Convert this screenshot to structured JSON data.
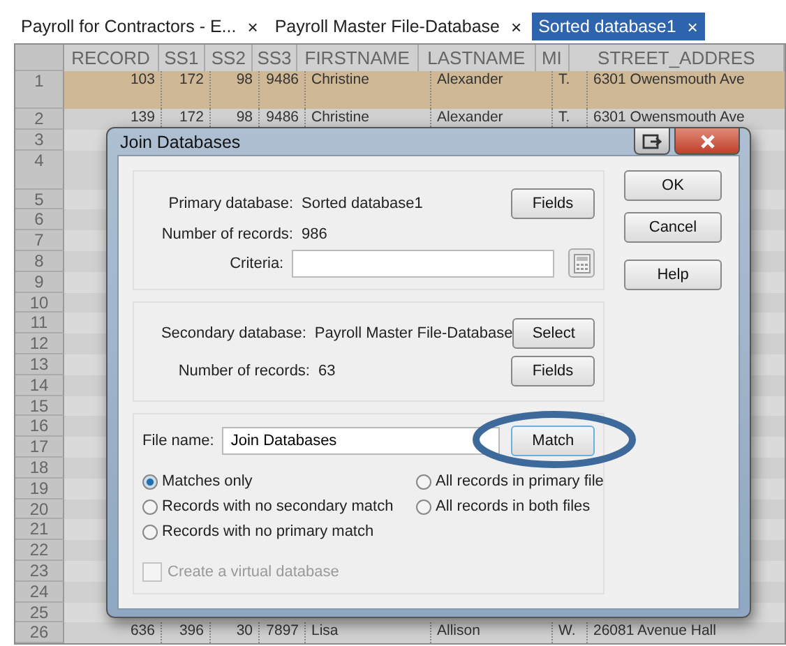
{
  "tabs": [
    {
      "label": "Payroll for Contractors - E...",
      "close": "×",
      "selected": false
    },
    {
      "label": "Payroll Master File-Database",
      "close": "×",
      "selected": false
    },
    {
      "label": "Sorted database1",
      "close": "×",
      "selected": true
    }
  ],
  "table": {
    "columns": [
      "RECORD",
      "SS1",
      "SS2",
      "SS3",
      "FIRSTNAME",
      "LASTNAME",
      "MI",
      "STREET_ADDRES"
    ],
    "rows": [
      {
        "number": "1",
        "selected": true,
        "cells": [
          "103",
          "172",
          "98",
          "9486",
          "Christine",
          "Alexander",
          "T.",
          "6301 Owensmouth Ave"
        ]
      },
      {
        "number": "2",
        "selected": false,
        "cells": [
          "139",
          "172",
          "98",
          "9486",
          "Christine",
          "Alexander",
          "T.",
          "6301 Owensmouth Ave"
        ]
      },
      {
        "number": "3",
        "selected": false
      },
      {
        "number": "4",
        "selected": false
      },
      {
        "number": "5",
        "selected": false
      },
      {
        "number": "6",
        "selected": false
      },
      {
        "number": "7",
        "selected": false
      },
      {
        "number": "8",
        "selected": false
      },
      {
        "number": "9",
        "selected": false
      },
      {
        "number": "10",
        "selected": false
      },
      {
        "number": "11",
        "selected": false
      },
      {
        "number": "12",
        "selected": false
      },
      {
        "number": "13",
        "selected": false
      },
      {
        "number": "14",
        "selected": false
      },
      {
        "number": "15",
        "selected": false
      },
      {
        "number": "16",
        "selected": false
      },
      {
        "number": "17",
        "selected": false
      },
      {
        "number": "18",
        "selected": false
      },
      {
        "number": "19",
        "selected": false
      },
      {
        "number": "20",
        "selected": false
      },
      {
        "number": "21",
        "selected": false
      },
      {
        "number": "22",
        "selected": false
      },
      {
        "number": "23",
        "selected": false
      },
      {
        "number": "24",
        "selected": false
      },
      {
        "number": "25",
        "selected": false
      },
      {
        "number": "26",
        "selected": false,
        "cells": [
          "636",
          "396",
          "30",
          "7897",
          "Lisa",
          "Allison",
          "W.",
          "26081 Avenue Hall"
        ]
      }
    ]
  },
  "dialog": {
    "title": "Join Databases",
    "primary": {
      "database_label": "Primary database:",
      "database": "Sorted database1",
      "records_label": "Number of records:",
      "records": "986",
      "criteria_label": "Criteria:",
      "fields_button": "Fields"
    },
    "secondary": {
      "database_label": "Secondary database:",
      "database": "Payroll Master File-Database",
      "records_label": "Number of records:",
      "records": "63",
      "select_button": "Select",
      "fields_button": "Fields"
    },
    "file_name_label": "File name:",
    "file_name": "Join Databases",
    "match_button": "Match",
    "options": [
      {
        "label": "Matches only",
        "selected": true
      },
      {
        "label": "All records in primary file",
        "selected": false
      },
      {
        "label": "Records with no secondary match",
        "selected": false
      },
      {
        "label": "All records in both files",
        "selected": false
      },
      {
        "label": "Records with no primary match",
        "selected": false
      }
    ],
    "virtual": {
      "label": "Create a virtual database",
      "checked": false,
      "disabled": true
    },
    "buttons": [
      "OK",
      "Cancel",
      "Help"
    ]
  }
}
